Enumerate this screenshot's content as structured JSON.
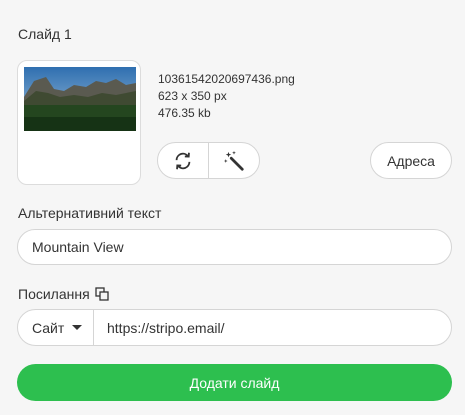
{
  "slide": {
    "title": "Слайд 1",
    "file": {
      "name": "10361542020697436.png",
      "dimensions": "623 x 350 px",
      "size": "476.35 kb"
    },
    "address_button": "Адреса"
  },
  "alt_text": {
    "label": "Альтернативний текст",
    "value": "Mountain View"
  },
  "link": {
    "label": "Посилання",
    "protocol": "Сайт",
    "url": "https://stripo.email/"
  },
  "add_slide_button": "Додати слайд",
  "colors": {
    "accent": "#2dbf4f",
    "background": "#f6f6f6",
    "border": "#d5d5d5"
  }
}
